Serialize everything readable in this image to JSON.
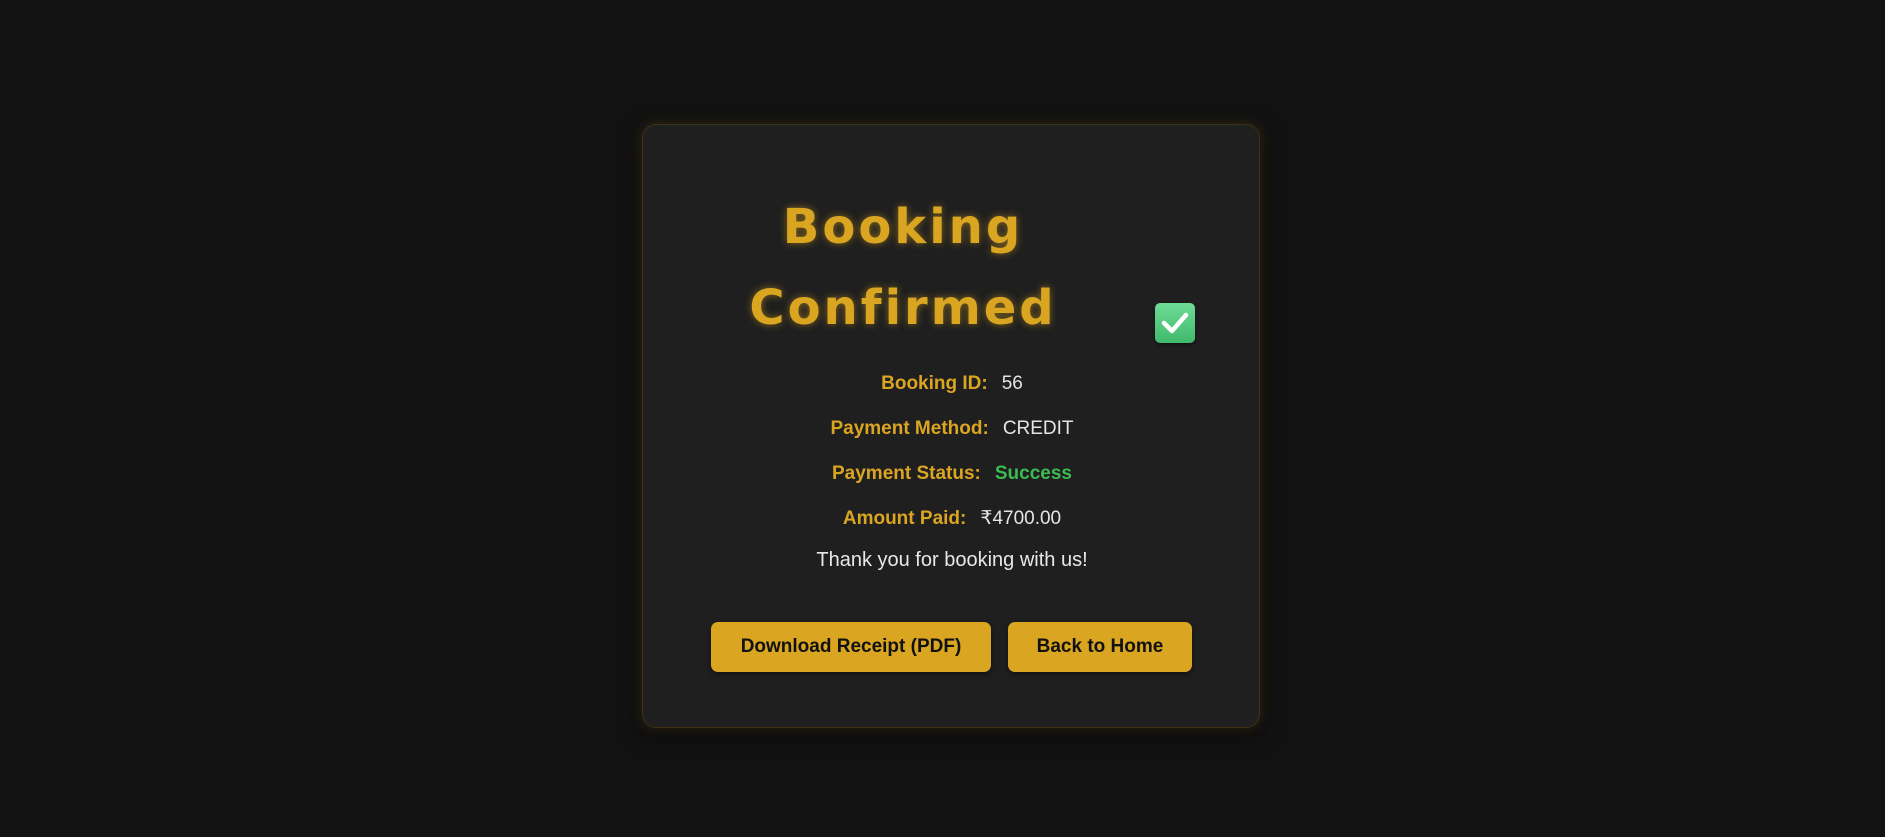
{
  "confirmation": {
    "title_line1": "Booking",
    "title_line2": "Confirmed",
    "status_icon": "check-mark-icon",
    "details": [
      {
        "label": "Booking ID:",
        "value": "56"
      },
      {
        "label": "Payment Method:",
        "value": "CREDIT"
      },
      {
        "label": "Payment Status:",
        "value": "Success"
      },
      {
        "label": "Amount Paid:",
        "value": "₹4700.00"
      }
    ],
    "thanks_message": "Thank you for booking with us!",
    "download_button_label": "Download Receipt (PDF)",
    "home_button_label": "Back to Home"
  },
  "colors": {
    "background": "#121212",
    "card": "#1f1f1f",
    "accent": "#daa520",
    "success": "#3dbb52",
    "check_icon": "#4fcb7d"
  }
}
